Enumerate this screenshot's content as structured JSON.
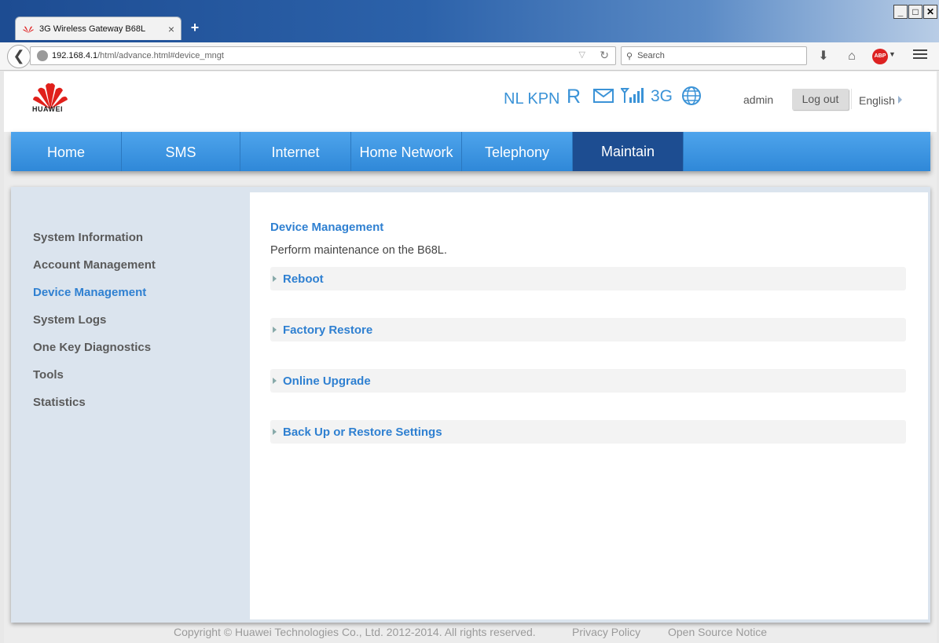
{
  "browser": {
    "tab_title": "3G Wireless Gateway B68L",
    "tab_close": "×",
    "new_tab": "+",
    "url_host": "192.168.4.1",
    "url_path": "/html/advance.html#device_mngt",
    "search_placeholder": "Search",
    "win_minimize": "_",
    "win_maximize": "□",
    "win_close": "✕",
    "abp_label": "ABP"
  },
  "header": {
    "logo_text": "HUAWEI",
    "operator": "NL KPN",
    "roaming": "R",
    "network_type": "3G",
    "user": "admin",
    "logout": "Log out",
    "language": "English"
  },
  "nav": {
    "items": [
      "Home",
      "SMS",
      "Internet",
      "Home Network",
      "Telephony",
      "Maintain"
    ],
    "active": "Maintain"
  },
  "sidebar": {
    "items": [
      "System Information",
      "Account Management",
      "Device Management",
      "System Logs",
      "One Key Diagnostics",
      "Tools",
      "Statistics"
    ],
    "active": "Device Management"
  },
  "panel": {
    "title": "Device Management",
    "description": "Perform maintenance on the B68L.",
    "sections": [
      "Reboot",
      "Factory Restore",
      "Online Upgrade",
      "Back Up or Restore Settings"
    ]
  },
  "footer": {
    "copyright": "Copyright © Huawei Technologies Co., Ltd. 2012-2014. All rights reserved.",
    "privacy": "Privacy Policy",
    "open_source": "Open Source Notice"
  },
  "colors": {
    "accent_blue": "#2f80d1",
    "nav_blue": "#3a93e0",
    "nav_active": "#1d4d91",
    "status_blue": "#3b93d7"
  }
}
